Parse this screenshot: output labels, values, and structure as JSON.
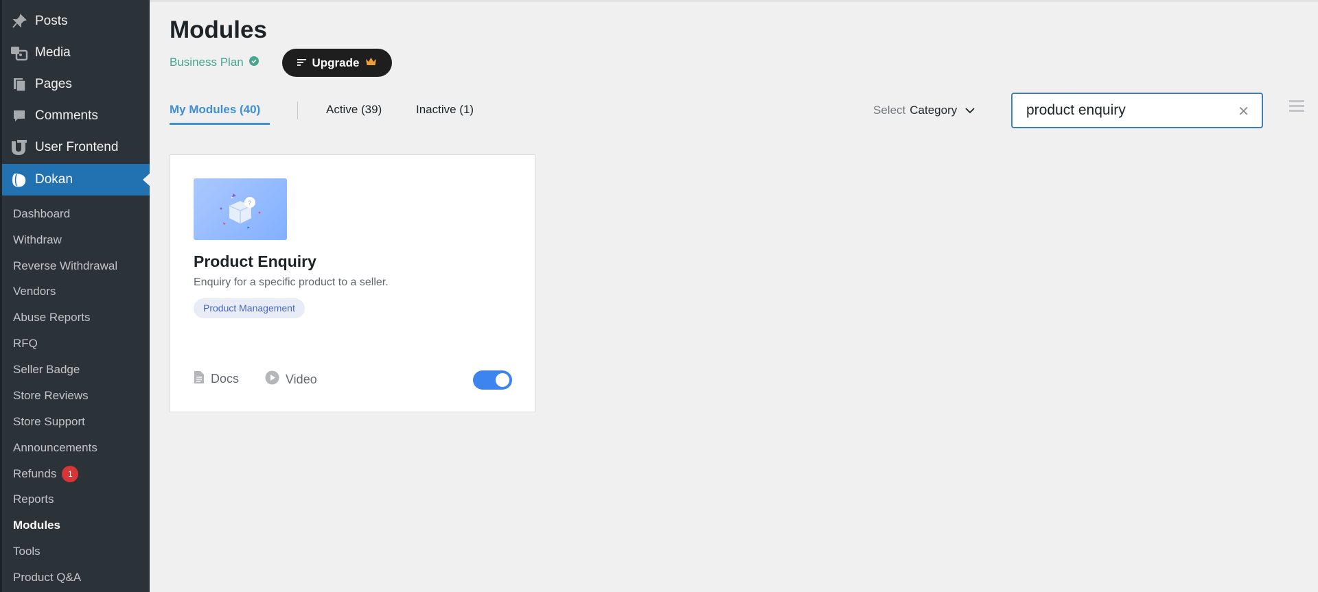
{
  "sidebar": {
    "top_items": [
      {
        "label": "Posts",
        "icon": "pin-icon"
      },
      {
        "label": "Media",
        "icon": "media-icon"
      },
      {
        "label": "Pages",
        "icon": "pages-icon"
      },
      {
        "label": "Comments",
        "icon": "comment-icon"
      },
      {
        "label": "User Frontend",
        "icon": "user-frontend-icon"
      },
      {
        "label": "Dokan",
        "icon": "dokan-icon"
      }
    ],
    "sub_items": [
      {
        "label": "Dashboard"
      },
      {
        "label": "Withdraw"
      },
      {
        "label": "Reverse Withdrawal"
      },
      {
        "label": "Vendors"
      },
      {
        "label": "Abuse Reports"
      },
      {
        "label": "RFQ"
      },
      {
        "label": "Seller Badge"
      },
      {
        "label": "Store Reviews"
      },
      {
        "label": "Store Support"
      },
      {
        "label": "Announcements"
      },
      {
        "label": "Refunds",
        "badge": "1"
      },
      {
        "label": "Reports"
      },
      {
        "label": "Modules"
      },
      {
        "label": "Tools"
      },
      {
        "label": "Product Q&A"
      }
    ]
  },
  "header": {
    "title": "Modules",
    "plan": "Business Plan",
    "upgrade_label": "Upgrade"
  },
  "tabs": [
    {
      "label": "My Modules (40)"
    },
    {
      "label": "Active (39)"
    },
    {
      "label": "Inactive (1)"
    }
  ],
  "filter": {
    "select_prefix": "Select",
    "select_value": "Category"
  },
  "search": {
    "value": "product enquiry"
  },
  "module": {
    "title": "Product Enquiry",
    "description": "Enquiry for a specific product to a seller.",
    "tag": "Product Management",
    "docs_label": "Docs",
    "video_label": "Video",
    "enabled": true
  },
  "colors": {
    "sidebar_bg": "#2c3338",
    "active_menu": "#2271b1",
    "accent": "#3f8fd2",
    "plan_green": "#46a68c",
    "toggle_on": "#3d84f0",
    "badge_red": "#d63638"
  }
}
